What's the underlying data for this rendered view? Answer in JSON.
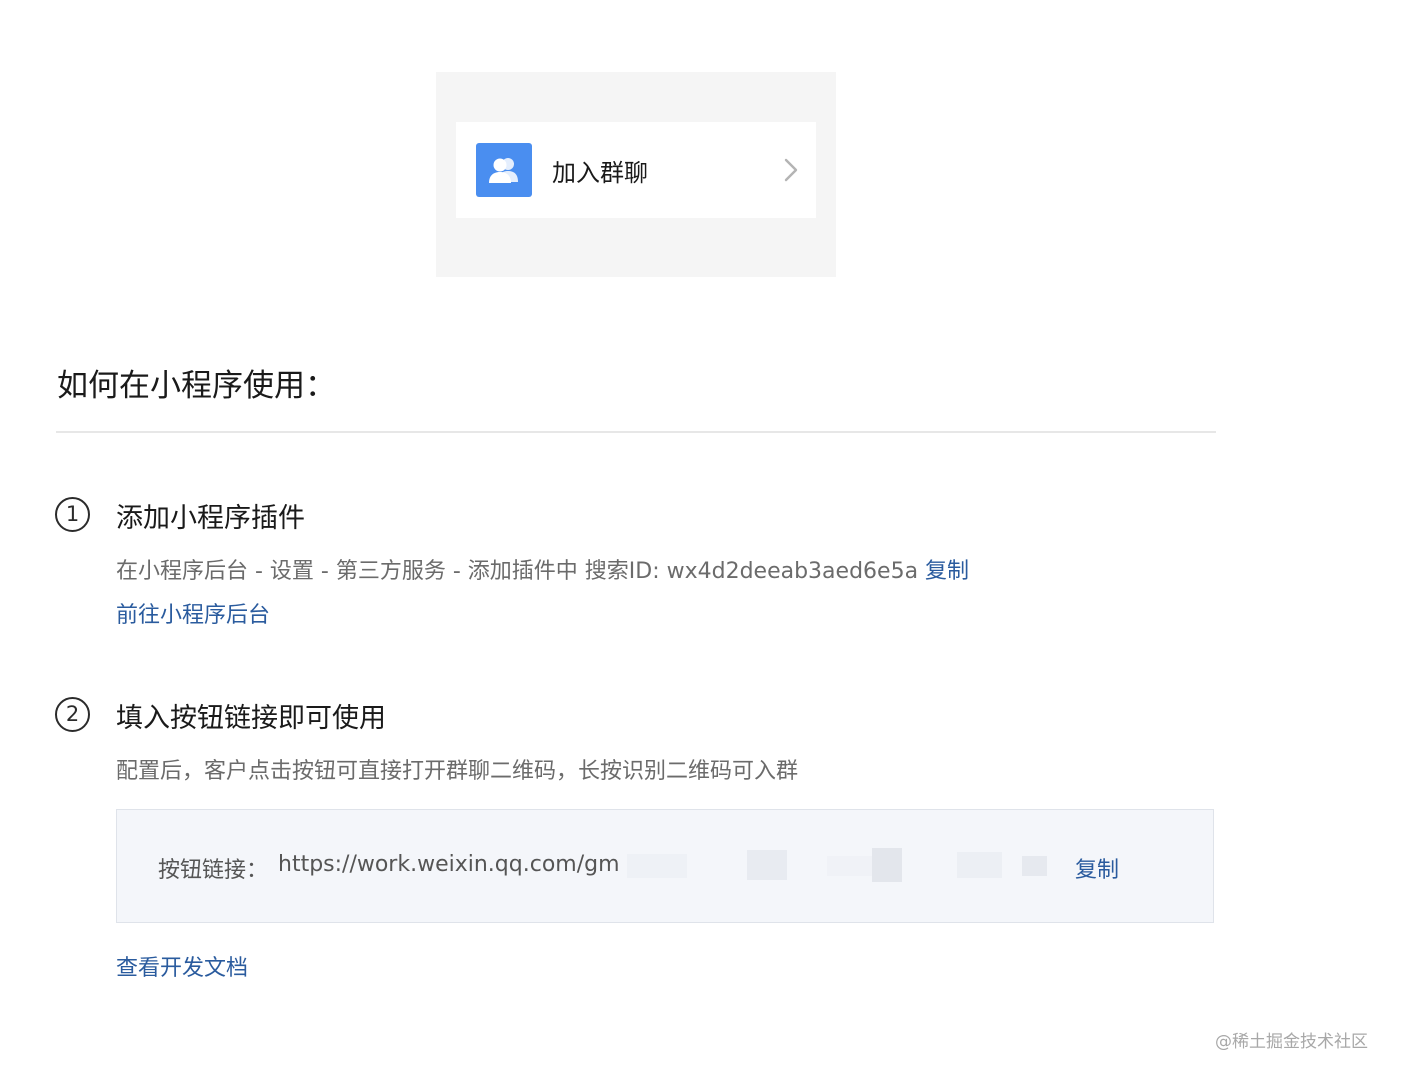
{
  "preview": {
    "group_button_label": "加入群聊",
    "group_icon": "users-icon",
    "chevron_icon": "chevron-right-icon",
    "icon_color": "#4a8ef0"
  },
  "section_title": "如何在小程序使用：",
  "steps": [
    {
      "number": "1",
      "title": "添加小程序插件",
      "description": "在小程序后台 - 设置 - 第三方服务 - 添加插件中 搜索ID: wx4d2deeab3aed6e5a",
      "copy_label": "复制",
      "link_label": "前往小程序后台"
    },
    {
      "number": "2",
      "title": "填入按钮链接即可使用",
      "description": "配置后，客户点击按钮可直接打开群聊二维码，长按识别二维码可入群",
      "link_box": {
        "label": "按钮链接：",
        "url": "https://work.weixin.qq.com/gm",
        "copy_label": "复制"
      },
      "docs_link": "查看开发文档"
    }
  ],
  "watermark": "@稀土掘金技术社区",
  "colors": {
    "link": "#2a5b9e",
    "muted_text": "#6b6b6b",
    "box_bg": "#f4f6fa"
  }
}
